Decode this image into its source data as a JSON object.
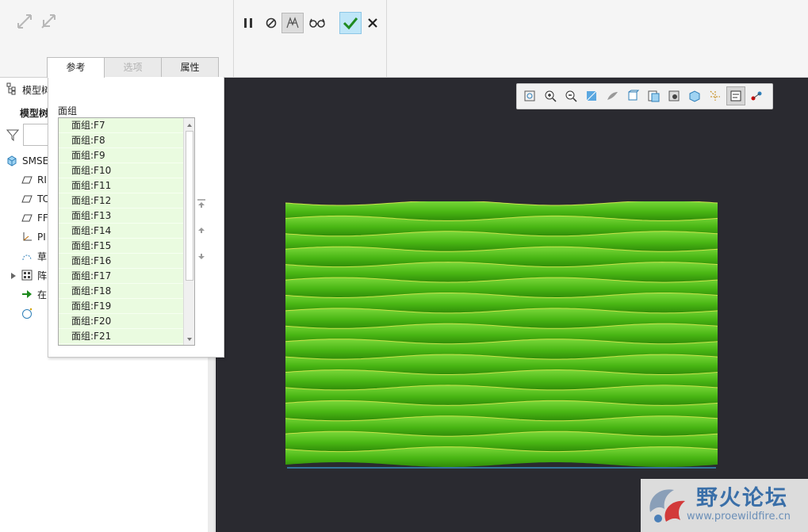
{
  "ribbon": {
    "tabs": [
      {
        "label": "参考",
        "state": "active"
      },
      {
        "label": "选项",
        "state": "disabled"
      },
      {
        "label": "属性",
        "state": "normal"
      }
    ],
    "icons": [
      "flip-arrows-icon",
      "flip-arrows-alt-icon",
      "pause-icon",
      "no-preview-icon",
      "verify-mesh-icon",
      "glasses-preview-icon",
      "confirm-check-icon",
      "cancel-x-icon"
    ]
  },
  "model_tree": {
    "header_label": "模型树",
    "subheader_label": "模型树",
    "items": [
      {
        "label": "SMSE",
        "icon": "part-cube-icon"
      },
      {
        "label": "RI",
        "icon": "datum-plane-icon"
      },
      {
        "label": "TC",
        "icon": "datum-plane-icon"
      },
      {
        "label": "FF",
        "icon": "datum-plane-icon"
      },
      {
        "label": "PI",
        "icon": "coordinate-system-icon"
      },
      {
        "label": "草",
        "icon": "sketch-icon"
      },
      {
        "label": "阵",
        "icon": "pattern-icon"
      },
      {
        "label": "在",
        "icon": "insert-here-arrow-icon"
      },
      {
        "label": "",
        "icon": "feature-in-progress-icon"
      }
    ]
  },
  "references_panel": {
    "group_label": "面组",
    "items": [
      "面组:F7",
      "面组:F8",
      "面组:F9",
      "面组:F10",
      "面组:F11",
      "面组:F12",
      "面组:F13",
      "面组:F14",
      "面组:F15",
      "面组:F16",
      "面组:F17",
      "面组:F18",
      "面组:F19",
      "面组:F20",
      "面组:F21"
    ]
  },
  "viewport": {
    "background": "#2a2a30",
    "surface_color": "#55c81e",
    "wave_rows": 17,
    "view_toolbar_icons": [
      "refit-icon",
      "zoom-in-icon",
      "zoom-out-icon",
      "repaint-icon",
      "display-style-icon",
      "saved-views-icon",
      "named-views-icon",
      "render-icon",
      "section-icon",
      "datum-display-icon",
      "annotation-display-icon",
      "spin-center-icon"
    ]
  },
  "watermark": {
    "title": "野火论坛",
    "url": "www.proewildfire.cn"
  }
}
